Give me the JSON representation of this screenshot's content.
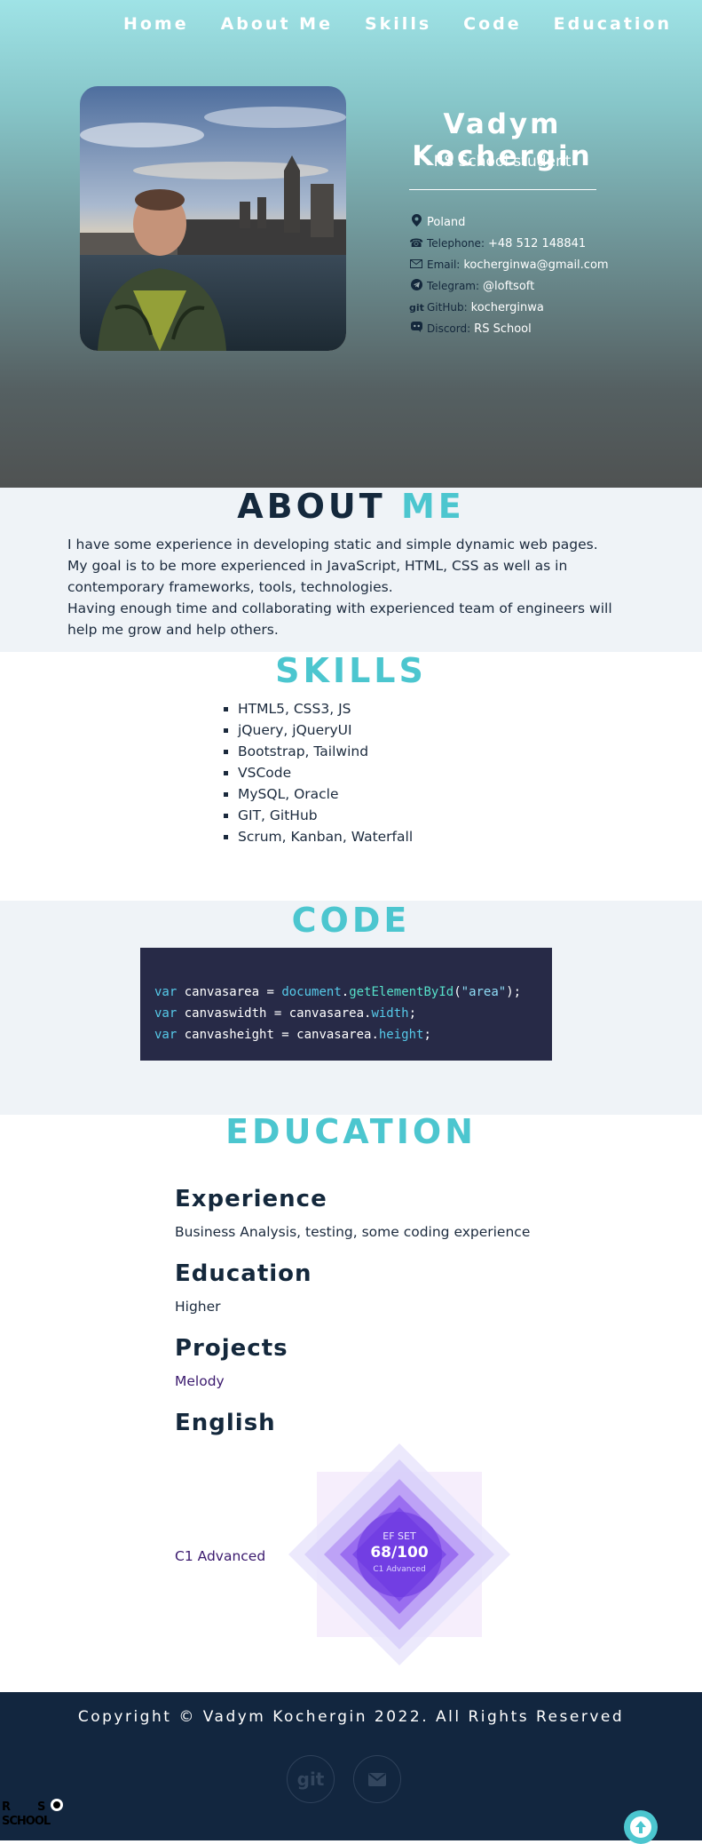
{
  "nav": [
    "Home",
    "About Me",
    "Skills",
    "Code",
    "Education"
  ],
  "profile": {
    "name": "Vadym Kochergin",
    "role": "RS School student"
  },
  "contacts": {
    "location": "Poland",
    "telephone_label": "Telephone:",
    "telephone": "+48 512 148841",
    "email_label": "Email:",
    "email": "kocherginwa@gmail.com",
    "telegram_label": "Telegram:",
    "telegram": "@loftsoft",
    "github_icon": "git",
    "github_label": "GitHub:",
    "github": "kocherginwa",
    "discord_label": "Discord:",
    "discord": "RS School"
  },
  "about": {
    "title_dark": "ABOUT",
    "title_accent": "ME",
    "lines": [
      "I have some experience in developing static and simple dynamic web pages.",
      "My goal is to be more experienced in JavaScript, HTML, CSS as well as in contemporary frameworks, tools, technologies.",
      "Having enough time and collaborating with experienced team of engineers will help me grow and help others."
    ]
  },
  "skills": {
    "title": "SKILLS",
    "items": [
      "HTML5, CSS3, JS",
      "jQuery, jQueryUI",
      "Bootstrap, Tailwind",
      "VSCode",
      "MySQL, Oracle",
      "GIT, GitHub",
      "Scrum, Kanban, Waterfall"
    ]
  },
  "code": {
    "title": "CODE",
    "line1": {
      "kw": "var",
      "name": " canvasarea = ",
      "obj": "document",
      "dot": ".",
      "fn": "getElementById",
      "open": "(",
      "str": "\"area\"",
      "close": ");"
    },
    "line2": {
      "kw": "var",
      "name": " canvaswidth = canvasarea.",
      "prop": "width",
      "end": ";"
    },
    "line3": {
      "kw": "var",
      "name": " canvasheight = canvasarea.",
      "prop": "height",
      "end": ";"
    }
  },
  "education": {
    "title": "EDUCATION",
    "experience_title": "Experience",
    "experience_text": "Business Analysis, testing, some coding experience",
    "education_title": "Education",
    "education_text": "Higher",
    "projects_title": "Projects",
    "projects_link": "Melody",
    "english_title": "English",
    "english_link": "C1 Advanced",
    "efset": {
      "brand": "EF SET",
      "score": "68/100",
      "level": "C1 Advanced"
    }
  },
  "footer": {
    "copyright": "Copyright © Vadym Kochergin 2022. All Rights Reserved",
    "git_button": "git",
    "logo_text": "RS SCHOOL"
  },
  "colors": {
    "accent": "#4cc6cf",
    "dark": "#14283c",
    "footer_bg": "#12263f"
  }
}
